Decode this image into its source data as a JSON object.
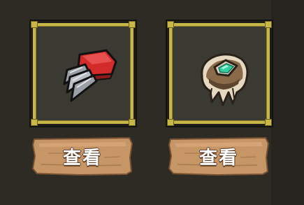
{
  "slots": [
    {
      "icon": "red-claw-glove-icon",
      "button_label": "查看"
    },
    {
      "icon": "fur-amulet-icon",
      "button_label": "查看"
    }
  ],
  "colors": {
    "frame_gold": "#c8b648",
    "slot_bg": "#3a3932",
    "wood_button": "#c79667",
    "background": "#2e2a24"
  }
}
